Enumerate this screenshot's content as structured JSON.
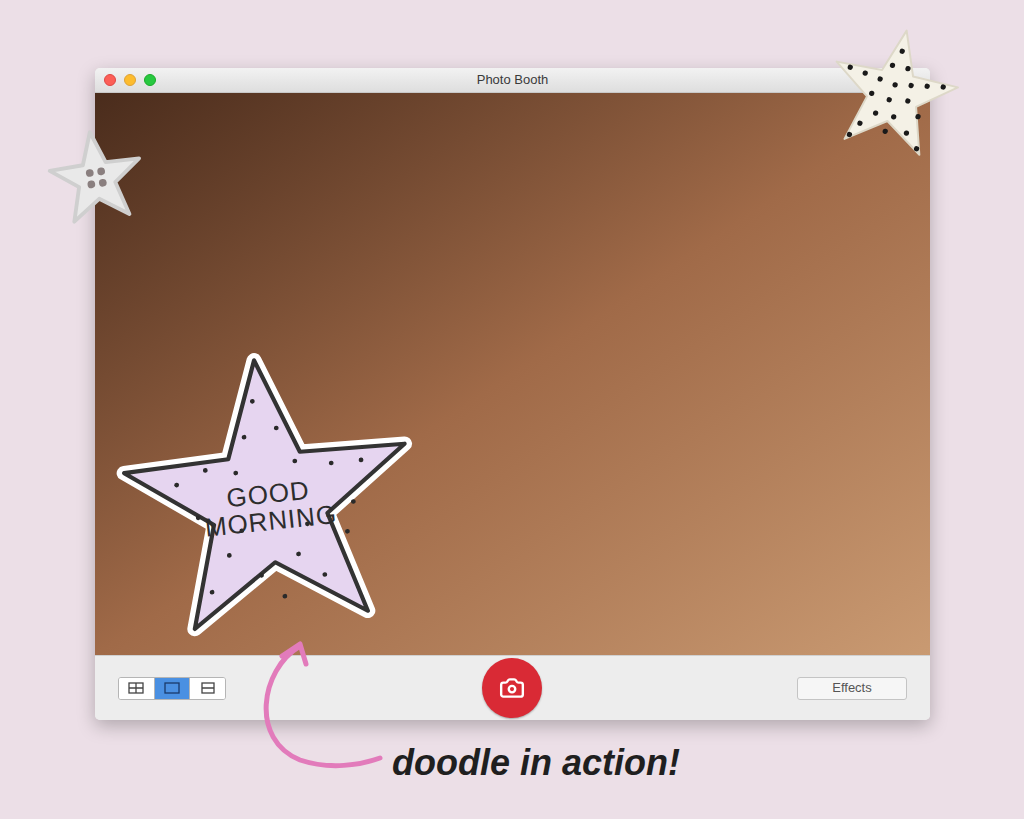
{
  "window": {
    "title": "Photo Booth"
  },
  "view_buttons": [
    {
      "kind": "grid",
      "selected": false
    },
    {
      "kind": "single",
      "selected": true
    },
    {
      "kind": "strip",
      "selected": false
    }
  ],
  "effects_button": {
    "label": "Effects"
  },
  "sticker": {
    "text": "GOOD MORNING"
  },
  "caption": {
    "text": "doodle in action!"
  }
}
